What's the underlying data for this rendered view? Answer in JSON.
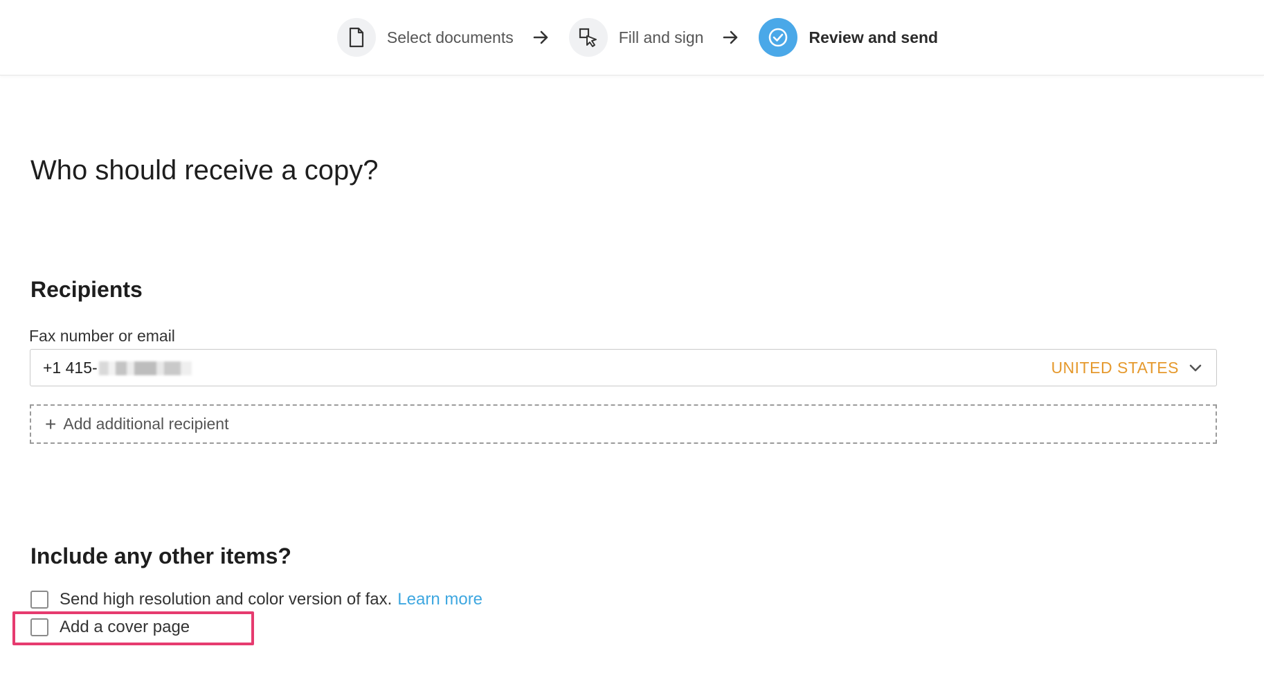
{
  "stepper": {
    "steps": [
      {
        "label": "Select documents",
        "icon": "document-icon",
        "active": false
      },
      {
        "label": "Fill and sign",
        "icon": "cursor-select-icon",
        "active": false
      },
      {
        "label": "Review and send",
        "icon": "check-circle-icon",
        "active": true
      }
    ],
    "arrow_icon": "arrow-right-icon"
  },
  "page_title": "Who should receive a copy?",
  "recipients": {
    "heading": "Recipients",
    "field_label": "Fax number or email",
    "fax_value_visible": "+1 415-",
    "country": "UNITED STATES",
    "add_label": "Add additional recipient"
  },
  "other_items": {
    "heading": "Include any other items?",
    "options": [
      {
        "label": "Send high resolution and color version of fax.",
        "link": "Learn more",
        "checked": false
      },
      {
        "label": "Add a cover page",
        "checked": false
      }
    ]
  },
  "colors": {
    "accent": "#4aa8e8",
    "country": "#e5992d",
    "link": "#3ea7e0",
    "highlight": "#e63b6f"
  }
}
